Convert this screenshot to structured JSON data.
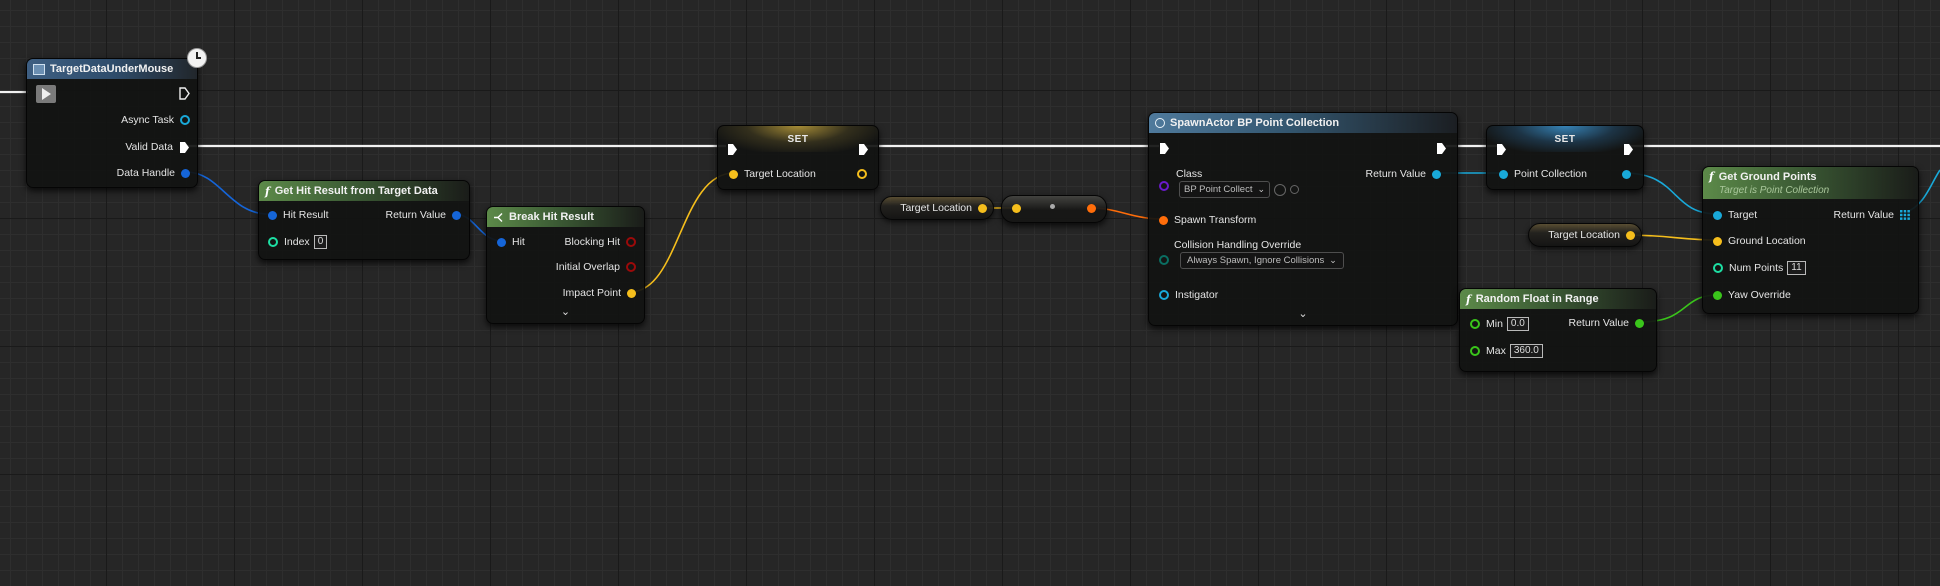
{
  "graph": {
    "colors": {
      "exec": "#ffffff",
      "struct_blue": "#1565d8",
      "object_cyan": "#19a9d9",
      "vector_yellow": "#f5be1c",
      "transform_orange": "#ff6d0a",
      "float_green": "#3ac51b",
      "bool_red": "#9b0a0a",
      "int_teal": "#1ddfa3",
      "class_purple": "#6a1acb"
    },
    "nodes": {
      "target_data": {
        "title": "TargetDataUnderMouse",
        "pins": {
          "async_task": "Async Task",
          "valid_data": "Valid Data",
          "data_handle": "Data Handle"
        }
      },
      "get_hit": {
        "title": "Get Hit Result from Target Data",
        "pins": {
          "hit_result": "Hit Result",
          "index": "Index",
          "index_value": "0",
          "return_value": "Return Value"
        }
      },
      "break_hit": {
        "title": "Break Hit Result",
        "pins": {
          "hit": "Hit",
          "blocking_hit": "Blocking Hit",
          "initial_overlap": "Initial Overlap",
          "impact_point": "Impact Point"
        }
      },
      "set1": {
        "title": "SET",
        "pins": {
          "target_location": "Target Location"
        }
      },
      "getter1": {
        "label": "Target Location"
      },
      "spawn": {
        "title": "SpawnActor BP Point Collection",
        "pins": {
          "class": "Class",
          "class_value": "BP Point Collect",
          "spawn_transform": "Spawn Transform",
          "collision": "Collision Handling Override",
          "collision_value": "Always Spawn, Ignore Collisions",
          "instigator": "Instigator",
          "return_value": "Return Value"
        }
      },
      "set2": {
        "title": "SET",
        "pins": {
          "point_collection": "Point Collection"
        }
      },
      "getter2": {
        "label": "Target Location"
      },
      "random": {
        "title": "Random Float in Range",
        "pins": {
          "min": "Min",
          "min_value": "0.0",
          "max": "Max",
          "max_value": "360.0",
          "return_value": "Return Value"
        }
      },
      "ground": {
        "title": "Get Ground Points",
        "subtitle": "Target is Point Collection",
        "pins": {
          "target": "Target",
          "ground_location": "Ground Location",
          "num_points": "Num Points",
          "num_points_value": "11",
          "yaw_override": "Yaw Override",
          "return_value": "Return Value"
        }
      }
    }
  }
}
